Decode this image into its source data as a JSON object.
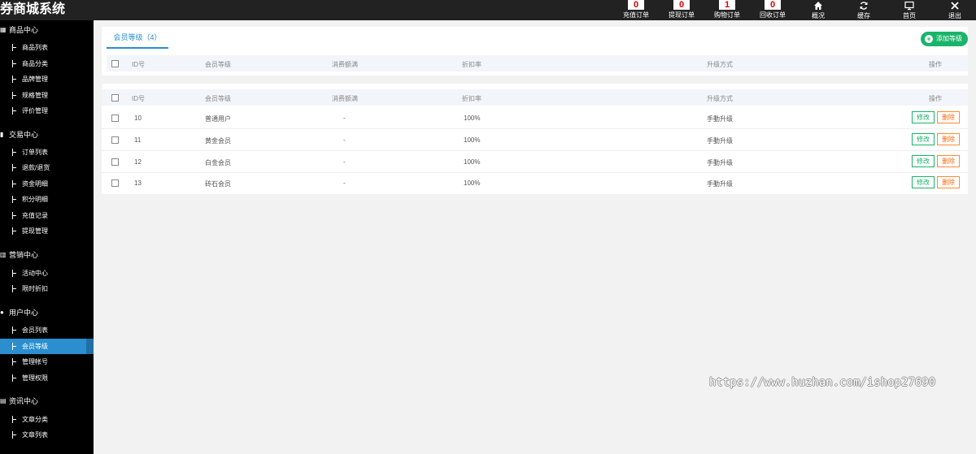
{
  "app": {
    "brand": "券商城系统"
  },
  "topbar": {
    "counters": [
      {
        "count": "0",
        "label": "充值订单"
      },
      {
        "count": "0",
        "label": "提现订单"
      },
      {
        "count": "1",
        "label": "购物订单"
      },
      {
        "count": "0",
        "label": "回收订单"
      }
    ],
    "actions": [
      {
        "icon": "home-icon",
        "label": "概况"
      },
      {
        "icon": "refresh-icon",
        "label": "缓存"
      },
      {
        "icon": "monitor-icon",
        "label": "首页"
      },
      {
        "icon": "close-icon",
        "label": "退出"
      }
    ]
  },
  "sidebar": {
    "groups": [
      {
        "label": "商品中心",
        "icon": "grid-icon",
        "items": [
          "商品列表",
          "商品分类",
          "品牌管理",
          "规格管理",
          "评价管理"
        ]
      },
      {
        "label": "交易中心",
        "icon": "bars-icon",
        "items": [
          "订单列表",
          "退款/退货",
          "资金明细",
          "积分明细",
          "充值记录",
          "提现管理"
        ]
      },
      {
        "label": "营销中心",
        "icon": "chart-icon",
        "items": [
          "活动中心",
          "限时折扣"
        ]
      },
      {
        "label": "用户中心",
        "icon": "user-icon",
        "items": [
          "会员列表",
          "会员等级",
          "管理帐号",
          "管理权限"
        ]
      },
      {
        "label": "资讯中心",
        "icon": "document-icon",
        "items": [
          "文章分类",
          "文章列表"
        ]
      }
    ],
    "active_item": "会员等级"
  },
  "main": {
    "tab_label": "会员等级（4）",
    "add_button": "添加等级",
    "columns": [
      "ID号",
      "会员等级",
      "消费额满",
      "折扣率",
      "升级方式",
      "操作"
    ],
    "rows": [
      {
        "id": "10",
        "level": "普通用户",
        "spend": "-",
        "discount": "100%",
        "upgrade": "手動升级"
      },
      {
        "id": "11",
        "level": "黄金会员",
        "spend": "-",
        "discount": "100%",
        "upgrade": "手動升级"
      },
      {
        "id": "12",
        "level": "白金会员",
        "spend": "-",
        "discount": "100%",
        "upgrade": "手動升级"
      },
      {
        "id": "13",
        "level": "砖石会员",
        "spend": "-",
        "discount": "100%",
        "upgrade": "手動升级"
      }
    ],
    "edit_label": "修改",
    "delete_label": "删除"
  },
  "watermark": "https://www.huzhan.com/ishop27690"
}
